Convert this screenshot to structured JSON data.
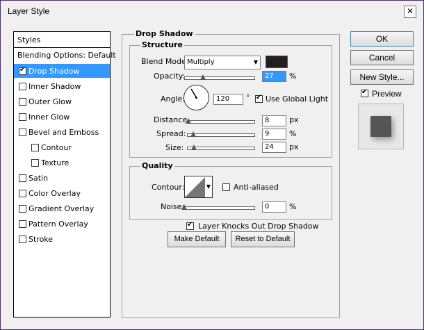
{
  "window": {
    "title": "Layer Style",
    "close_icon": "close-icon"
  },
  "styles_panel": {
    "header": "Styles",
    "blending_options": "Blending Options: Default",
    "items": [
      {
        "label": "Drop Shadow",
        "checked": true,
        "active": true
      },
      {
        "label": "Inner Shadow",
        "checked": false
      },
      {
        "label": "Outer Glow",
        "checked": false
      },
      {
        "label": "Inner Glow",
        "checked": false
      },
      {
        "label": "Bevel and Emboss",
        "checked": false
      },
      {
        "label": "Contour",
        "checked": false,
        "indent": true
      },
      {
        "label": "Texture",
        "checked": false,
        "indent": true
      },
      {
        "label": "Satin",
        "checked": false
      },
      {
        "label": "Color Overlay",
        "checked": false
      },
      {
        "label": "Gradient Overlay",
        "checked": false
      },
      {
        "label": "Pattern Overlay",
        "checked": false
      },
      {
        "label": "Stroke",
        "checked": false
      }
    ]
  },
  "drop_shadow": {
    "title": "Drop Shadow",
    "structure": {
      "title": "Structure",
      "blend_mode_label": "Blend Mode:",
      "blend_mode_value": "Multiply",
      "blend_color": "#231f20",
      "opacity_label": "Opacity:",
      "opacity_value": "27",
      "opacity_unit": "%",
      "opacity_fraction": 0.27,
      "angle_label": "Angle:",
      "angle_value": "120",
      "angle_unit": "°",
      "use_global_light_label": "Use Global Light",
      "use_global_light": true,
      "distance_label": "Distance:",
      "distance_value": "8",
      "distance_unit": "px",
      "distance_fraction": 0.02,
      "spread_label": "Spread:",
      "spread_value": "9",
      "spread_unit": "%",
      "spread_fraction": 0.09,
      "size_label": "Size:",
      "size_value": "24",
      "size_unit": "px",
      "size_fraction": 0.1
    },
    "quality": {
      "title": "Quality",
      "contour_label": "Contour:",
      "anti_aliased_label": "Anti-aliased",
      "anti_aliased": false,
      "noise_label": "Noise:",
      "noise_value": "0",
      "noise_unit": "%",
      "noise_fraction": 0
    },
    "knockout_label": "Layer Knocks Out Drop Shadow",
    "knockout": true,
    "make_default_label": "Make Default",
    "reset_default_label": "Reset to Default"
  },
  "actions": {
    "ok_label": "OK",
    "cancel_label": "Cancel",
    "new_style_label": "New Style...",
    "preview_label": "Preview",
    "preview_checked": true
  },
  "colors": {
    "selection": "#3399ff",
    "dialog_bg": "#f0f0f0",
    "desktop": "#5b3a7a"
  }
}
